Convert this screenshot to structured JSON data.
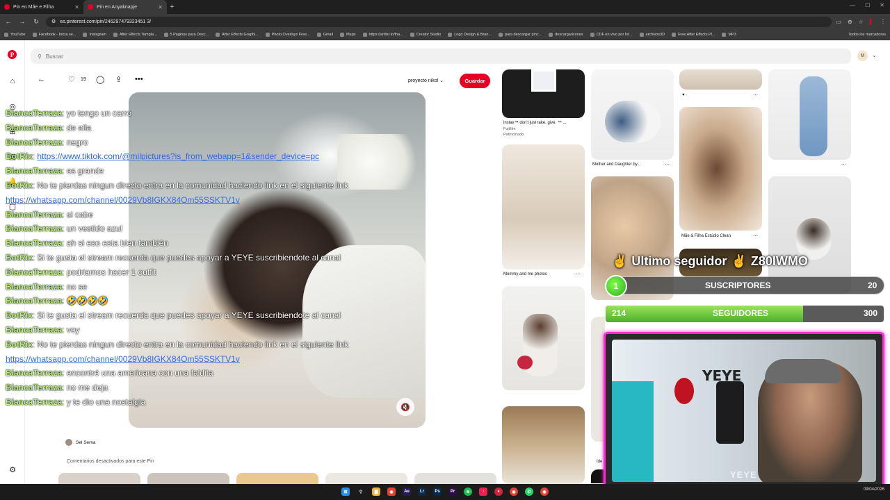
{
  "browser": {
    "tabs": [
      {
        "label": "Pin en Mãe e Filha",
        "active": false
      },
      {
        "label": "Pin en Anyaknapje",
        "active": true
      }
    ],
    "url": "es.pinterest.com/pin/246297479323451 3/",
    "bookmarks": [
      "YouTube",
      "Facebook - Inicia se...",
      "Instagram",
      "After Effects Templa...",
      "5 Páginas para Desc...",
      "After Effects Graphi...",
      "Photo Overlays Free...",
      "Gmail",
      "Maps",
      "https://artlist.io/tha...",
      "Creator Studio",
      "Logo Design & Bran...",
      "para descargar pinc...",
      "descargaricones",
      "CDF en vivo por Int...",
      "archivos3D",
      "Free After Effects Pl...",
      "MP3"
    ],
    "bookmarks_folder": "Todos los marcadores"
  },
  "pinterest": {
    "search_placeholder": "Buscar",
    "avatar_initial": "M",
    "likes": "19",
    "board": "proyecto nikol",
    "save": "Guardar",
    "author": "Sel Serna",
    "comments_off": "Comentarios desactivados para este Pin",
    "grid": {
      "instax_title": "instax™ don't just take, give. ™ ...",
      "instax_brand": "Fujifilm",
      "instax_sponsored": "Patrocinado",
      "mother_daughter": "Mother and Daughter by...",
      "mommy_photos": "Mommy and me photos",
      "mae_filha": "Mãe & Filha Estúdio Clean",
      "heart_caption": "♥ ·",
      "ide_caption": "Ide"
    }
  },
  "chat": [
    {
      "user": "BiancaTerraza",
      "msg": "yo tengo un carro"
    },
    {
      "user": "BiancaTerraza",
      "msg": "de ella"
    },
    {
      "user": "BiancaTerraza",
      "msg": "negro"
    },
    {
      "user": "BotRix",
      "msg": "",
      "link": "https://www.tiktok.com/@milpictures?is_from_webapp=1&sender_device=pc"
    },
    {
      "user": "BiancaTerraza",
      "msg": "es grande"
    },
    {
      "user": "BotRix",
      "msg": "No te pierdas ningun directo entra en la comunidad haciendo link en el siguiente link"
    },
    {
      "user": "",
      "msg": "",
      "link": "https://whatsapp.com/channel/0029Vb8IGKX84Om55SSKTV1v"
    },
    {
      "user": "BiancaTerraza",
      "msg": "si cabe"
    },
    {
      "user": "BiancaTerraza",
      "msg": "un vestido azul"
    },
    {
      "user": "BiancaTerraza",
      "msg": "ah si eso esta bien también"
    },
    {
      "user": "BotRix",
      "msg": "Si te gusta el stream recuerda que puedes apoyar a YEYE suscribiendote al canal"
    },
    {
      "user": "BiancaTerraza",
      "msg": "podriamos hacer 1 outfit"
    },
    {
      "user": "BiancaTerraza",
      "msg": "no se"
    },
    {
      "user": "BiancaTerraza",
      "msg": "🤣🤣🤣🤣"
    },
    {
      "user": "BotRix",
      "msg": "Si te gusta el stream recuerda que puedes apoyar a YEYE suscribiendote al canal"
    },
    {
      "user": "BiancaTerraza",
      "msg": "voy"
    },
    {
      "user": "BotRix",
      "msg": "No te pierdas ningun directo entra en la comunidad haciendo link en el siguiente link"
    },
    {
      "user": "",
      "msg": "",
      "link": "https://whatsapp.com/channel/0029Vb8IGKX84Om55SSKTV1v"
    },
    {
      "user": "BiancaTerraza",
      "msg": "encontré una americana con una faldita"
    },
    {
      "user": "BiancaTerraza",
      "msg": "no me deja"
    },
    {
      "user": "BiancaTerraza",
      "msg": "y te dio una nostalgia"
    }
  ],
  "stream": {
    "last_follower_label": "Ultimo seguidor",
    "last_follower_name": "Z80IWMO",
    "subs_current": "1",
    "subs_label": "SUSCRIPTORES",
    "subs_goal": "20",
    "followers_current": "214",
    "followers_label": "SEGUIDORES",
    "followers_goal": "300",
    "followers_progress": 0.71,
    "cam_sign": "YEYE",
    "cam_brand": "YEYE"
  },
  "taskbar": {
    "clock": "09/04/2026"
  },
  "colors": {
    "pinterest_red": "#e60023",
    "chat_user": "#b6f07a",
    "link_blue": "#2f6be0",
    "overlay_pink": "#ff2bd6",
    "goal_green": "#4caf2a"
  }
}
